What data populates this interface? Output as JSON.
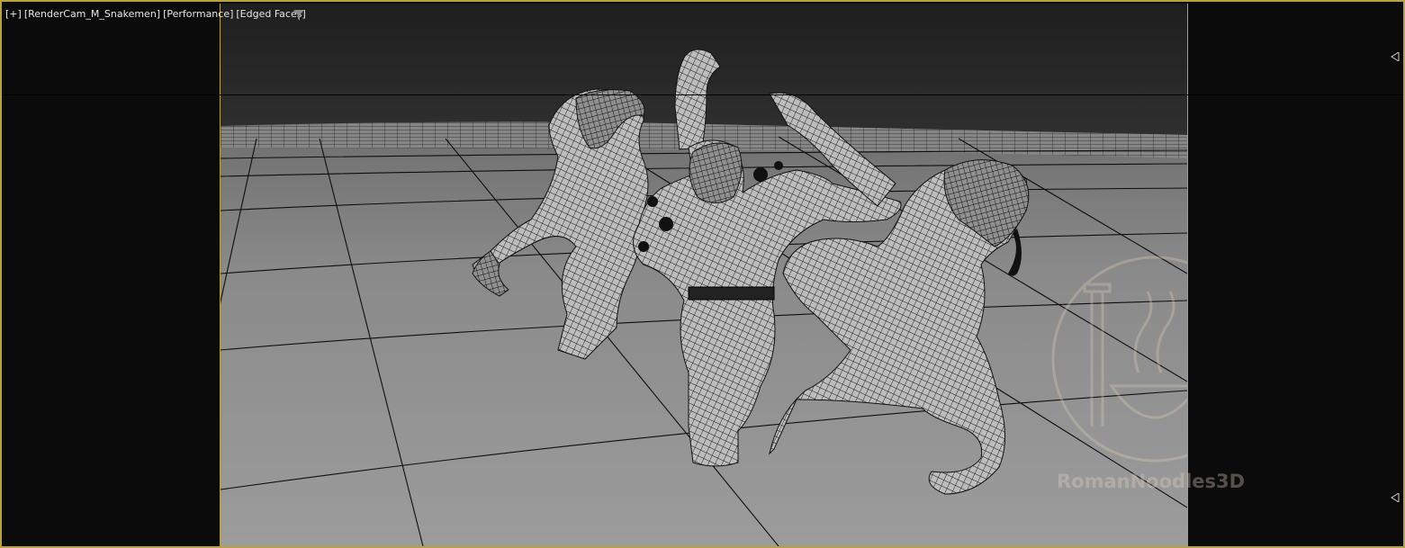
{
  "viewport": {
    "labels": {
      "plus": "[+]",
      "camera": "[RenderCam_M_Snakemen]",
      "shading": "[Performance]",
      "display": "[Edged Faces]"
    },
    "icons": {
      "filter": "filter-icon",
      "marker_top": "triangle-marker-icon",
      "marker_bottom": "triangle-marker-icon",
      "watermark_logo": "temple-noodle-bowl-logo"
    }
  },
  "watermark": {
    "text": "RomanNoodles3D"
  },
  "colors": {
    "frame_border": "#b7a23f",
    "background": "#0b0b0b",
    "sky": "#262626",
    "ground": "#8c8c8c"
  }
}
